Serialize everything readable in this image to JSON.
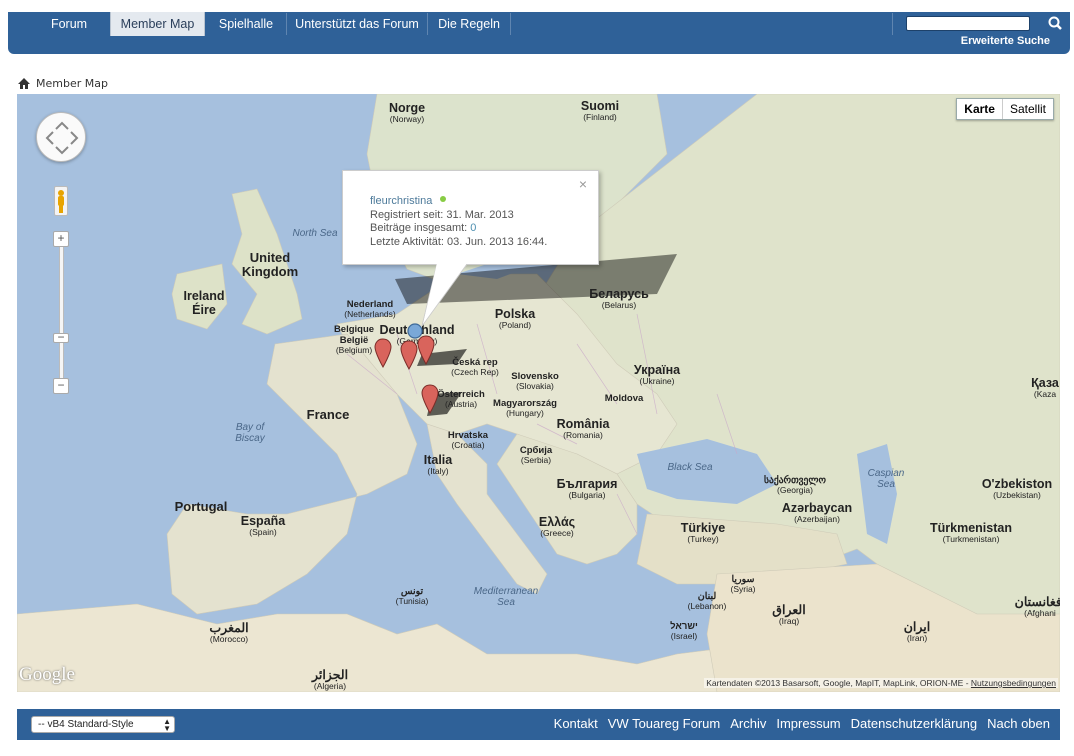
{
  "nav": {
    "tabs": [
      {
        "label": "Forum"
      },
      {
        "label": "Member Map"
      },
      {
        "label": "Spielhalle"
      },
      {
        "label": "Unterstützt das Forum"
      },
      {
        "label": "Die Regeln"
      }
    ],
    "search_icon": "search-icon",
    "advanced_search": "Erweiterte Suche"
  },
  "breadcrumb": {
    "home_icon": "home-icon",
    "label": "Member Map"
  },
  "map": {
    "type_buttons": {
      "map": "Karte",
      "satellite": "Satellit"
    },
    "zoom_in": "+",
    "zoom_out": "−",
    "labels": [
      {
        "name": "Norge",
        "sub": "(Norway)"
      },
      {
        "name": "Suomi",
        "sub": "(Finland)"
      },
      {
        "name": "United Kingdom",
        "sub": ""
      },
      {
        "name": "Ireland",
        "sub": ""
      },
      {
        "name": "Éire",
        "sub": ""
      },
      {
        "name": "Nederland",
        "sub": "(Netherlands)"
      },
      {
        "name": "Belgique",
        "sub": ""
      },
      {
        "name": "België",
        "sub": "(Belgium)"
      },
      {
        "name": "Deutschland",
        "sub": "(Germany)"
      },
      {
        "name": "Polska",
        "sub": "(Poland)"
      },
      {
        "name": "Беларусь",
        "sub": "(Belarus)"
      },
      {
        "name": "Česká rep",
        "sub": "(Czech Rep)"
      },
      {
        "name": "Slovensko",
        "sub": "(Slovakia)"
      },
      {
        "name": "Україна",
        "sub": "(Ukraine)"
      },
      {
        "name": "Moldova",
        "sub": ""
      },
      {
        "name": "Österreich",
        "sub": "(Austria)"
      },
      {
        "name": "Magyarország",
        "sub": "(Hungary)"
      },
      {
        "name": "România",
        "sub": "(Romania)"
      },
      {
        "name": "France",
        "sub": ""
      },
      {
        "name": "Hrvatska",
        "sub": "(Croatia)"
      },
      {
        "name": "Србија",
        "sub": "(Serbia)"
      },
      {
        "name": "Italia",
        "sub": "(Italy)"
      },
      {
        "name": "България",
        "sub": "(Bulgaria)"
      },
      {
        "name": "Portugal",
        "sub": ""
      },
      {
        "name": "España",
        "sub": "(Spain)"
      },
      {
        "name": "Ελλάς",
        "sub": "(Greece)"
      },
      {
        "name": "Türkiye",
        "sub": "(Turkey)"
      },
      {
        "name": "საქართველო",
        "sub": "(Georgia)"
      },
      {
        "name": "Azərbaycan",
        "sub": "(Azerbaijan)"
      },
      {
        "name": "Türkmenistan",
        "sub": "(Turkmenistan)"
      },
      {
        "name": "O'zbekiston",
        "sub": "(Uzbekistan)"
      },
      {
        "name": "Қаза",
        "sub": "(Kaza"
      },
      {
        "name": "تونس",
        "sub": "(Tunisia)"
      },
      {
        "name": "المغرب",
        "sub": "(Morocco)"
      },
      {
        "name": "الجزائر",
        "sub": "(Algeria)"
      },
      {
        "name": "سوريا",
        "sub": "(Syria)"
      },
      {
        "name": "لبنان",
        "sub": "(Lebanon)"
      },
      {
        "name": "ישראל",
        "sub": "(Israel)"
      },
      {
        "name": "العراق",
        "sub": "(Iraq)"
      },
      {
        "name": "ایران",
        "sub": "(Iran)"
      },
      {
        "name": "افغانستان",
        "sub": "(Afghani"
      }
    ],
    "seas": [
      {
        "name": "North Sea"
      },
      {
        "name": "Bay of Biscay"
      },
      {
        "name": "Black Sea"
      },
      {
        "name": "Caspian Sea"
      },
      {
        "name": "Mediterranean Sea"
      }
    ],
    "infowindow": {
      "username": "fleurchristina",
      "registered_label": "Registriert seit:",
      "registered_value": "31. Mar. 2013",
      "posts_label": "Beiträge insgesamt:",
      "posts_value": "0",
      "activity_label": "Letzte Aktivität:",
      "activity_value": "03. Jun. 2013 16:44.",
      "close": "×"
    },
    "google_logo": "Google",
    "copyright": "Kartendaten ©2013 Basarsoft, Google, MapIT, MapLink, ORION-ME -",
    "terms": "Nutzungsbedingungen",
    "marker_colors": {
      "member": "#d9645c",
      "current": "#7aa8d8"
    }
  },
  "footer": {
    "style_select": "-- vB4 Standard-Style",
    "links": [
      "Kontakt",
      "VW Touareg Forum",
      "Archiv",
      "Impressum",
      "Datenschutzerklärung",
      "Nach oben"
    ]
  }
}
